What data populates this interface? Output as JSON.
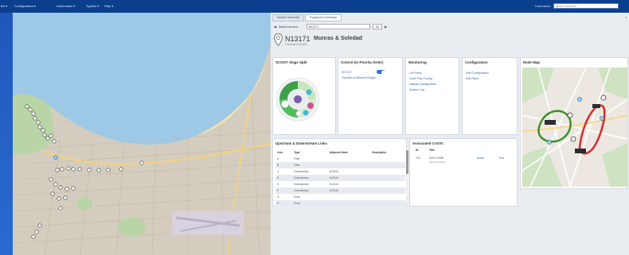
{
  "menu": [
    {
      "label": "tiol ▾"
    },
    {
      "label": "Configuration ▾"
    },
    {
      "label": "Automation ▾"
    },
    {
      "label": "System ▾"
    },
    {
      "label": "Help ▾"
    }
  ],
  "command": {
    "label": "Command:",
    "placeholder": "Enter command"
  },
  "tabs": [
    {
      "label": "System Summary"
    },
    {
      "label": "Equipment Summary"
    }
  ],
  "search": {
    "label": "Search by item:",
    "value": "N13171",
    "go_label": "Go"
  },
  "node": {
    "id": "N13171",
    "name": "Munras & Soledad",
    "subtitle": "Full-reset 4/1/2020"
  },
  "cards": {
    "stage_split": {
      "title": "SCOOT Stage Split"
    },
    "control": {
      "title": "Control (In Priority Order)",
      "items": [
        {
          "label": "SCOOT"
        },
        {
          "label": "Transfer to different Region"
        }
      ]
    },
    "monitoring": {
      "title": "Monitoring",
      "items": [
        {
          "label": "List Plans"
        },
        {
          "label": "Node Plan Tuning"
        },
        {
          "label": "Display Configuration"
        },
        {
          "label": "System Log"
        }
      ]
    },
    "configuration": {
      "title": "Configuration",
      "items": [
        {
          "label": "Edit Configuration"
        },
        {
          "label": "Edit Plans"
        }
      ]
    },
    "node_map": {
      "title": "Node Map"
    }
  },
  "links": {
    "title": "Upstream & Downstream Links",
    "columns": [
      "Link",
      "Type",
      "Adjacent Node",
      "Description"
    ],
    "rows": [
      {
        "link": "A",
        "type": "Filter",
        "node": "",
        "desc": ""
      },
      {
        "link": "B",
        "type": "Filter",
        "node": "",
        "desc": ""
      },
      {
        "link": "C",
        "type": "Downstream",
        "node": "N13161",
        "desc": ""
      },
      {
        "link": "D",
        "type": "Downstream",
        "node": "N13161",
        "desc": ""
      },
      {
        "link": "E",
        "type": "Downstream",
        "node": "N13161",
        "desc": ""
      },
      {
        "link": "F",
        "type": "Downstream",
        "node": "N13181",
        "desc": ""
      },
      {
        "link": "G",
        "type": "Entry",
        "node": "",
        "desc": ""
      },
      {
        "link": "H",
        "type": "Entry",
        "node": "",
        "desc": ""
      }
    ]
  },
  "cases": {
    "title": "Associated CASTs",
    "columns": [
      "ID",
      "Title"
    ],
    "rows": [
      {
        "id": "T10",
        "title": "DACO NMB",
        "title2": "Munras Emitter",
        "action": "Action",
        "edit": "Edit"
      }
    ]
  },
  "colors": {
    "topbar": "#0b3f8e",
    "accent_link": "#3464b8",
    "water": "#9ec9e6",
    "green_corridor": "#3d8f2a",
    "red_corridor": "#d52b2b"
  }
}
